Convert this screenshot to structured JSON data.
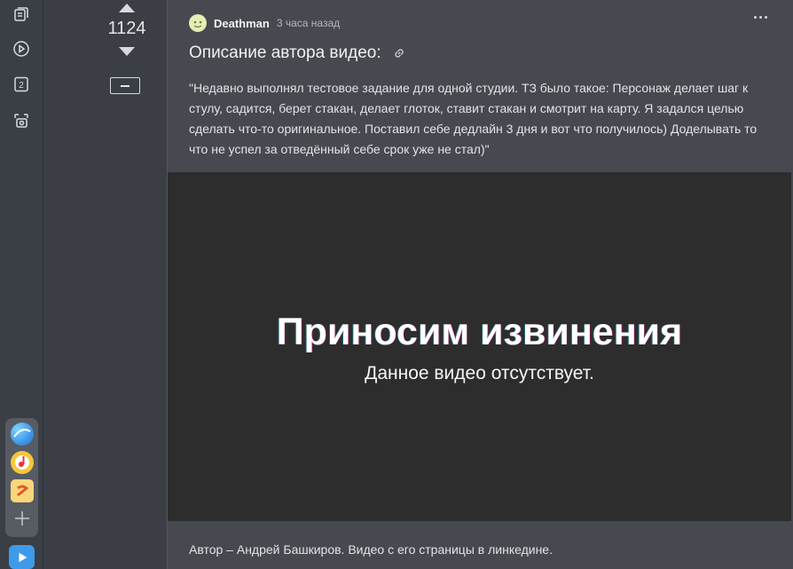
{
  "vote": {
    "count": "1124"
  },
  "post": {
    "author": "Deathman",
    "timestamp": "3 часа назад",
    "title": "Описание автора видео:",
    "text": "\"Недавно выполнял тестовое задание для одной студии. ТЗ было такое: Персонаж делает шаг к стулу, садится, берет стакан, делает глоток, ставит стакан и смотрит на карту. Я задался целью сделать что-то оригинальное. Поставил себе дедлайн 3 дня и вот что получилось) Доделывать то что не успел за отведённый себе срок уже не стал)\"",
    "footer": "Автор – Андрей Башкиров. Видео с его страницы в линкедине."
  },
  "video": {
    "title": "Приносим извинения",
    "subtitle": "Данное видео отсутствует."
  },
  "sidebar": {
    "icons": [
      "collections-icon",
      "play-icon",
      "two-icon",
      "screenshot-icon"
    ],
    "badge_number": "2",
    "apps": [
      "globe-app-icon",
      "music-app-icon",
      "notes-app-icon",
      "add-icon"
    ]
  },
  "colors": {
    "background": "#3b3f45",
    "card": "#46494f",
    "video_bg": "#2d2d2d",
    "accent_blue": "#3d9be9"
  }
}
